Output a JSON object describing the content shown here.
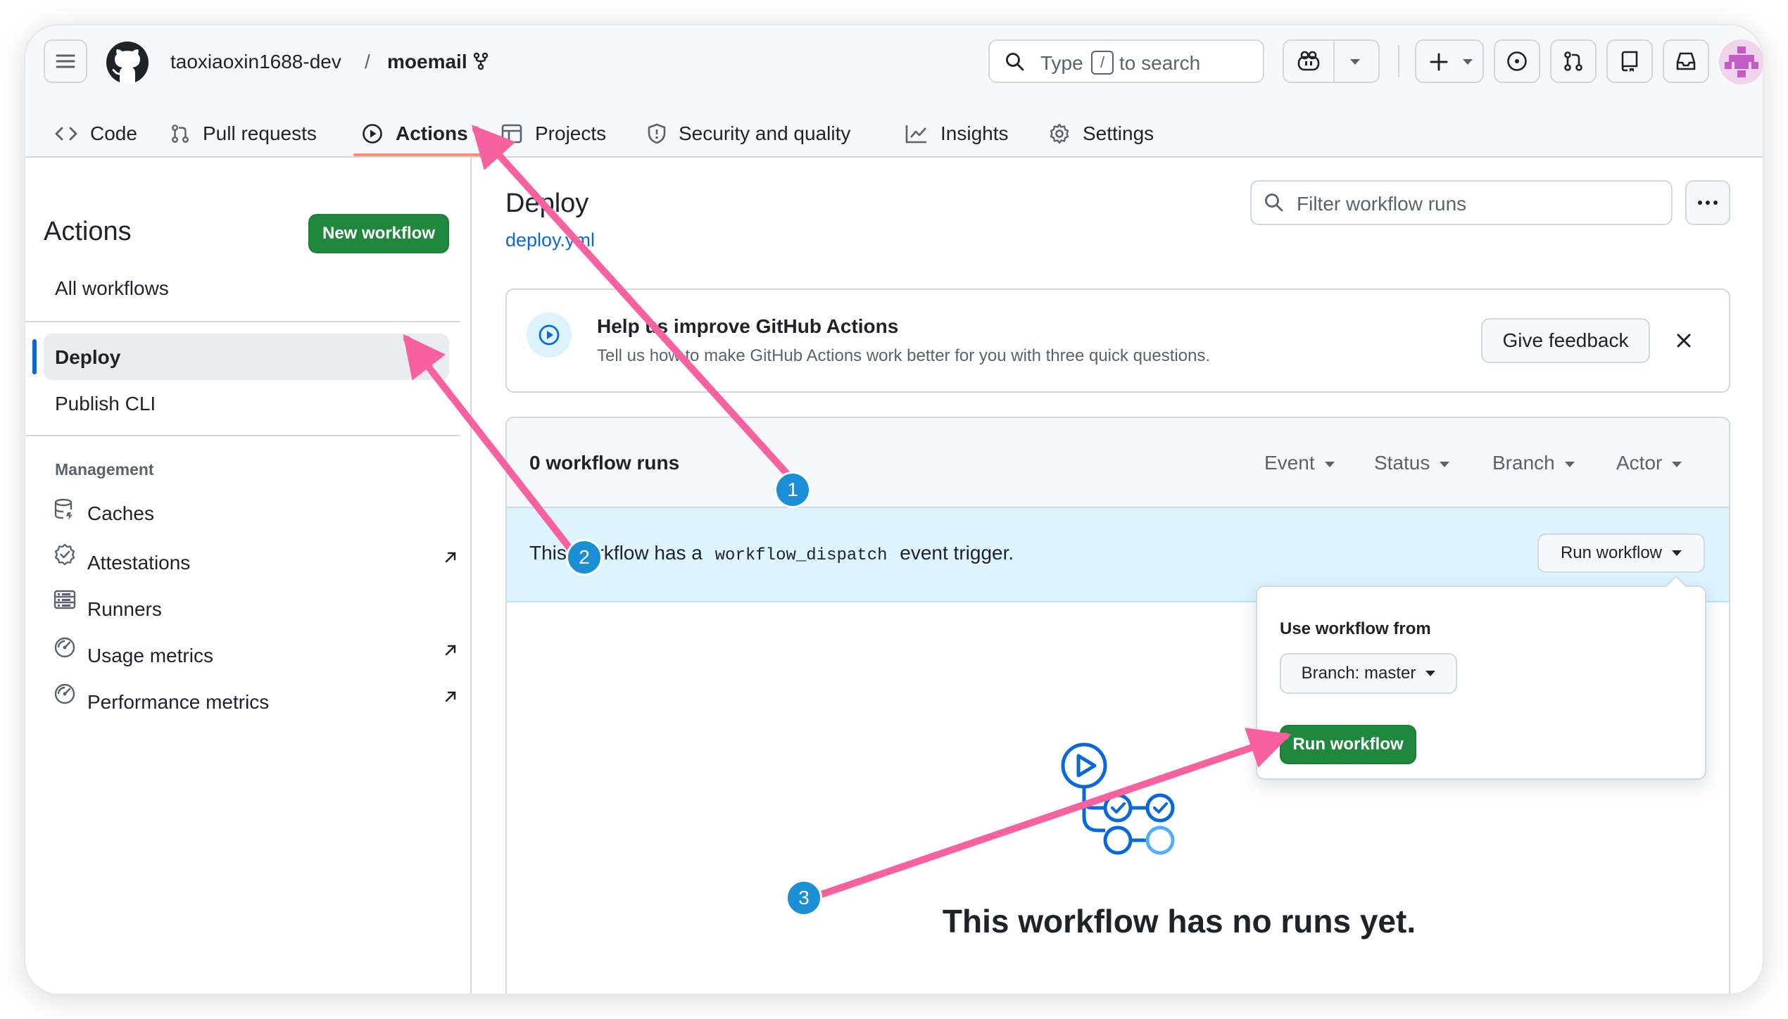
{
  "header": {
    "owner": "taoxiaoxin1688-dev",
    "separator": "/",
    "repo": "moemail",
    "search": {
      "prefix": "Type",
      "key": "/",
      "suffix": "to search"
    }
  },
  "tabs": [
    {
      "label": "Code"
    },
    {
      "label": "Pull requests"
    },
    {
      "label": "Actions"
    },
    {
      "label": "Projects"
    },
    {
      "label": "Security and quality"
    },
    {
      "label": "Insights"
    },
    {
      "label": "Settings"
    }
  ],
  "sidebar": {
    "title": "Actions",
    "new_workflow": "New workflow",
    "all_workflows": "All workflows",
    "workflows": [
      "Deploy",
      "Publish CLI"
    ],
    "management_label": "Management",
    "management": [
      "Caches",
      "Attestations",
      "Runners",
      "Usage metrics",
      "Performance metrics"
    ]
  },
  "main": {
    "title": "Deploy",
    "file_link": "deploy.yml",
    "filter_placeholder": "Filter workflow runs",
    "feedback": {
      "title": "Help us improve GitHub Actions",
      "text": "Tell us how to make GitHub Actions work better for you with three quick questions.",
      "button": "Give feedback"
    },
    "runs": {
      "count_label": "0 workflow runs",
      "filters": [
        "Event",
        "Status",
        "Branch",
        "Actor"
      ],
      "trigger_prefix": "This workflow has a",
      "trigger_code": "workflow_dispatch",
      "trigger_suffix": "event trigger.",
      "run_button": "Run workflow",
      "empty": "This workflow has no runs yet."
    },
    "popover": {
      "title": "Use workflow from",
      "branch": "Branch: master",
      "run": "Run workflow"
    }
  },
  "annotations": [
    "1",
    "2",
    "3"
  ],
  "colors": {
    "accent_pink": "#f7619f",
    "badge_blue": "#1b8fd6",
    "green": "#1f883d",
    "link": "#0969da"
  }
}
